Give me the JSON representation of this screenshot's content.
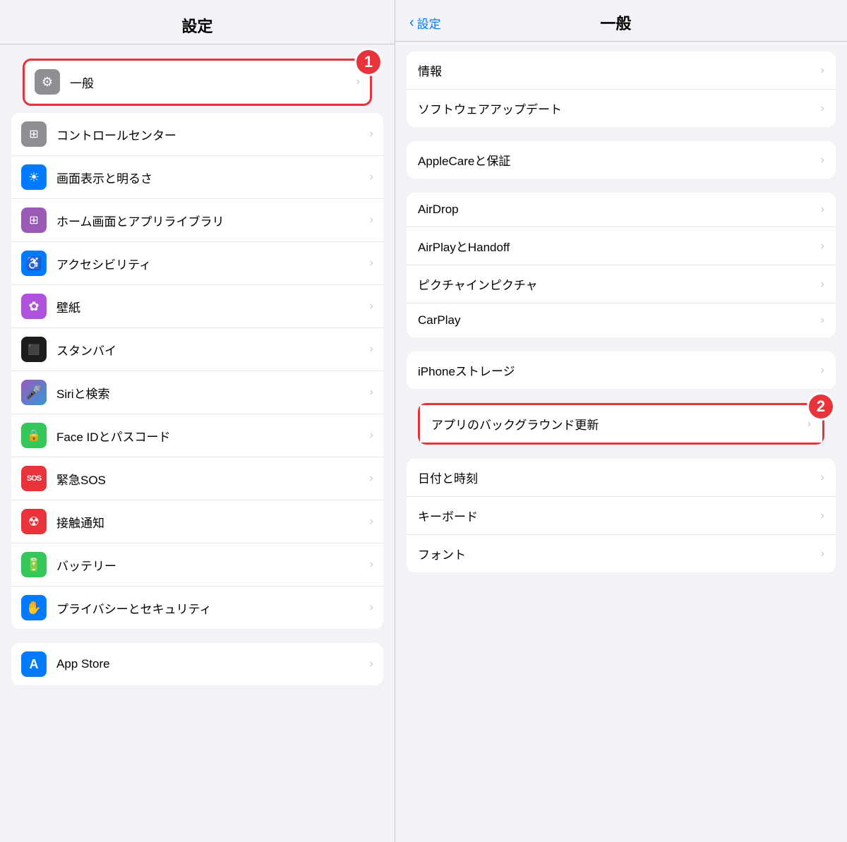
{
  "left": {
    "title": "設定",
    "highlighted_item": {
      "label": "一般",
      "badge": "1"
    },
    "groups": [
      {
        "id": "group-general",
        "items": [
          {
            "id": "general",
            "label": "一般",
            "icon_bg": "#8e8e93",
            "icon": "⚙️",
            "highlighted": true
          }
        ]
      },
      {
        "id": "group-main",
        "items": [
          {
            "id": "control-center",
            "label": "コントロールセンター",
            "icon_bg": "#8e8e93",
            "icon": "🎛"
          },
          {
            "id": "display",
            "label": "画面表示と明るさ",
            "icon_bg": "#007aff",
            "icon": "☀️"
          },
          {
            "id": "home-screen",
            "label": "ホーム画面とアプリライブラリ",
            "icon_bg": "#9b59b6",
            "icon": "⚏"
          },
          {
            "id": "accessibility",
            "label": "アクセシビリティ",
            "icon_bg": "#007aff",
            "icon": "♿"
          },
          {
            "id": "wallpaper",
            "label": "壁紙",
            "icon_bg": "#af52de",
            "icon": "✿"
          },
          {
            "id": "standby",
            "label": "スタンバイ",
            "icon_bg": "#1c1c1e",
            "icon": "⬛"
          },
          {
            "id": "siri",
            "label": "Siriと検索",
            "icon_bg": "#000",
            "icon": "🎤"
          },
          {
            "id": "faceid",
            "label": "Face IDとパスコード",
            "icon_bg": "#34c759",
            "icon": "🔒"
          },
          {
            "id": "sos",
            "label": "緊急SOS",
            "icon_bg": "#e8333a",
            "icon": "SOS"
          },
          {
            "id": "contact",
            "label": "接触通知",
            "icon_bg": "#e8333a",
            "icon": "☢"
          },
          {
            "id": "battery",
            "label": "バッテリー",
            "icon_bg": "#34c759",
            "icon": "🔋"
          },
          {
            "id": "privacy",
            "label": "プライバシーとセキュリティ",
            "icon_bg": "#007aff",
            "icon": "✋"
          }
        ]
      },
      {
        "id": "group-appstore",
        "items": [
          {
            "id": "appstore",
            "label": "App Store",
            "icon_bg": "#007aff",
            "icon": "A"
          }
        ]
      }
    ]
  },
  "right": {
    "back_label": "設定",
    "title": "一般",
    "badge2": "2",
    "groups": [
      {
        "id": "group-r1",
        "items": [
          {
            "id": "info",
            "label": "情報"
          },
          {
            "id": "software-update",
            "label": "ソフトウェアアップデート"
          }
        ]
      },
      {
        "id": "group-r2",
        "items": [
          {
            "id": "applecare",
            "label": "AppleCareと保証"
          }
        ]
      },
      {
        "id": "group-r3",
        "items": [
          {
            "id": "airdrop",
            "label": "AirDrop"
          },
          {
            "id": "airplay",
            "label": "AirPlayとHandoff"
          },
          {
            "id": "pip",
            "label": "ピクチャインピクチャ"
          },
          {
            "id": "carplay",
            "label": "CarPlay"
          }
        ]
      },
      {
        "id": "group-r4",
        "items": [
          {
            "id": "iphone-storage",
            "label": "iPhoneストレージ"
          }
        ]
      },
      {
        "id": "group-r5-highlighted",
        "highlighted": true,
        "items": [
          {
            "id": "background-refresh",
            "label": "アプリのバックグラウンド更新"
          }
        ]
      },
      {
        "id": "group-r6",
        "items": [
          {
            "id": "datetime",
            "label": "日付と時刻"
          },
          {
            "id": "keyboard",
            "label": "キーボード"
          },
          {
            "id": "fonts",
            "label": "フォント"
          }
        ]
      }
    ]
  },
  "icons": {
    "gear": "⚙",
    "control": "⊞",
    "chevron": "›"
  }
}
